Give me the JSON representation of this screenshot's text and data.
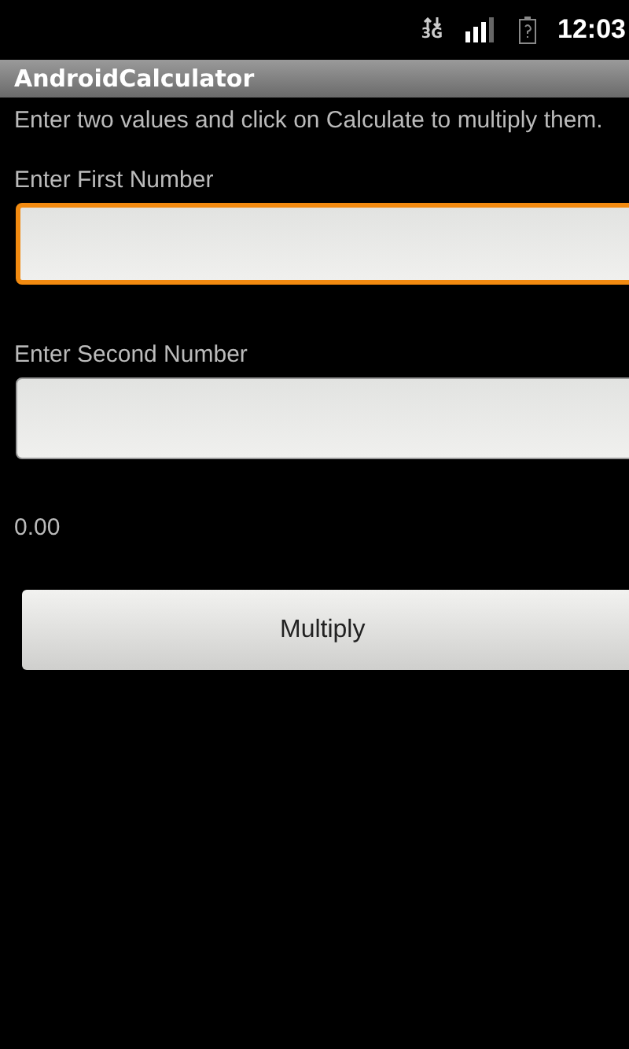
{
  "status_bar": {
    "network": "3G",
    "time": "12:03"
  },
  "title_bar": {
    "title": "AndroidCalculator"
  },
  "instructions": "Enter two values and click on Calculate to multiply them.",
  "fields": [
    {
      "label": "Enter First Number",
      "focused": true
    },
    {
      "label": "Enter Second Number",
      "focused": false
    }
  ],
  "result": "0.00",
  "button": {
    "label": "Multiply"
  }
}
